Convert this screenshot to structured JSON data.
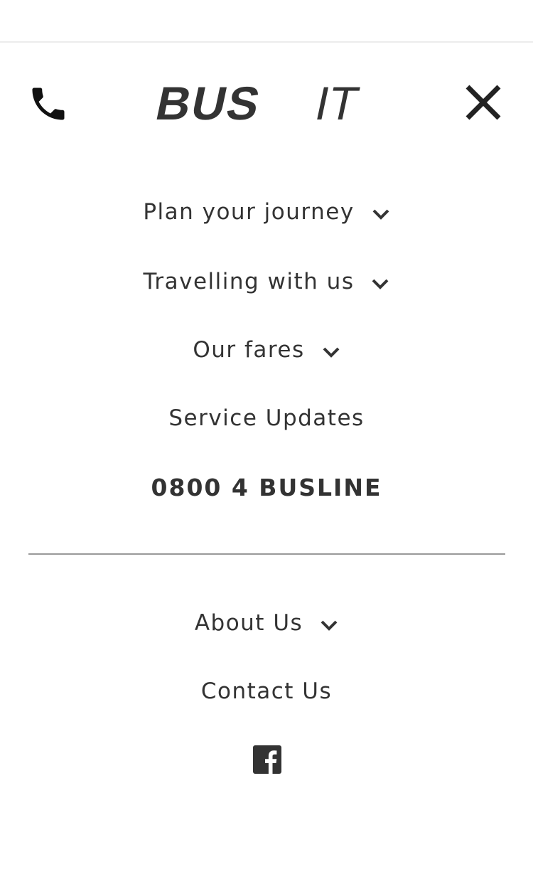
{
  "brand": {
    "logo_text_bold": "BUS",
    "logo_text_light": "IT",
    "color_text": "#333333",
    "color_rule": "#9a9a9a"
  },
  "header": {
    "phone_icon": "phone-icon",
    "close_icon": "close-icon"
  },
  "menu": {
    "primary": [
      {
        "label": "Plan your journey",
        "has_dropdown": true
      },
      {
        "label": "Travelling with us",
        "has_dropdown": true
      },
      {
        "label": "Our fares",
        "has_dropdown": true
      },
      {
        "label": "Service Updates",
        "has_dropdown": false
      }
    ],
    "phone_number": "0800 4 BUSLINE",
    "secondary": [
      {
        "label": "About Us",
        "has_dropdown": true
      },
      {
        "label": "Contact Us",
        "has_dropdown": false
      }
    ]
  },
  "social": {
    "facebook_icon": "facebook-icon"
  }
}
